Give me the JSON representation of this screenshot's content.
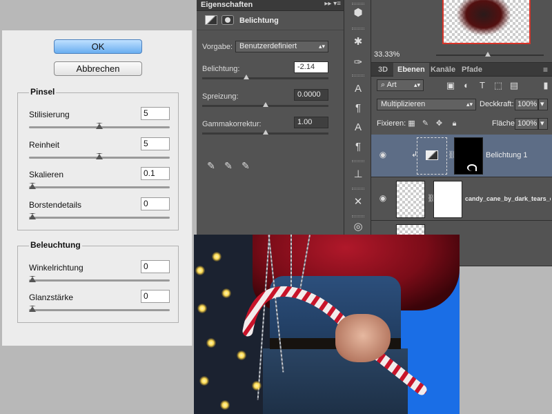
{
  "filter_dialog": {
    "ok_label": "OK",
    "cancel_label": "Abbrechen",
    "pinsel": {
      "title": "Pinsel",
      "params": [
        {
          "label": "Stilisierung",
          "value": "5",
          "level": 0.5
        },
        {
          "label": "Reinheit",
          "value": "5",
          "level": 0.5
        },
        {
          "label": "Skalieren",
          "value": "0.1",
          "level": 0.0
        },
        {
          "label": "Borstendetails",
          "value": "0",
          "level": 0.0
        }
      ]
    },
    "beleuchtung": {
      "title": "Beleuchtung",
      "params": [
        {
          "label": "Winkelrichtung",
          "value": "0",
          "level": 0.0
        },
        {
          "label": "Glanzstärke",
          "value": "0",
          "level": 0.0
        }
      ]
    }
  },
  "properties": {
    "title": "Eigenschaften",
    "adjustment_name": "Belichtung",
    "preset_label": "Vorgabe:",
    "preset_value": "Benutzerdefiniert",
    "rows": [
      {
        "label": "Belichtung:",
        "value": "-2.14",
        "level": 0.35
      },
      {
        "label": "Spreizung:",
        "value": "0.0000",
        "level": 0.5
      },
      {
        "label": "Gammakorrektur:",
        "value": "1.00",
        "level": 0.5
      }
    ]
  },
  "navigator": {
    "zoom": "33.33%"
  },
  "layers": {
    "tabs": [
      "3D",
      "Ebenen",
      "Kanäle",
      "Pfade"
    ],
    "active_tab": "Ebenen",
    "filter_kind": "Art",
    "blend_mode": "Multiplizieren",
    "opacity_label": "Deckkraft:",
    "opacity": "100%",
    "lock_label": "Fixieren:",
    "fill_label": "Fläche:",
    "fill": "100%",
    "items": [
      {
        "name": "Belichtung 1",
        "selected": true
      },
      {
        "name": "candy_cane_by_dark_tears_e",
        "selected": false
      },
      {
        "name": "",
        "selected": false
      }
    ]
  },
  "colors": {
    "panel": "#535353",
    "selection": "#5d6d86",
    "ok_button": "#6aaef0",
    "canvas_blue": "#1a6ee6"
  }
}
